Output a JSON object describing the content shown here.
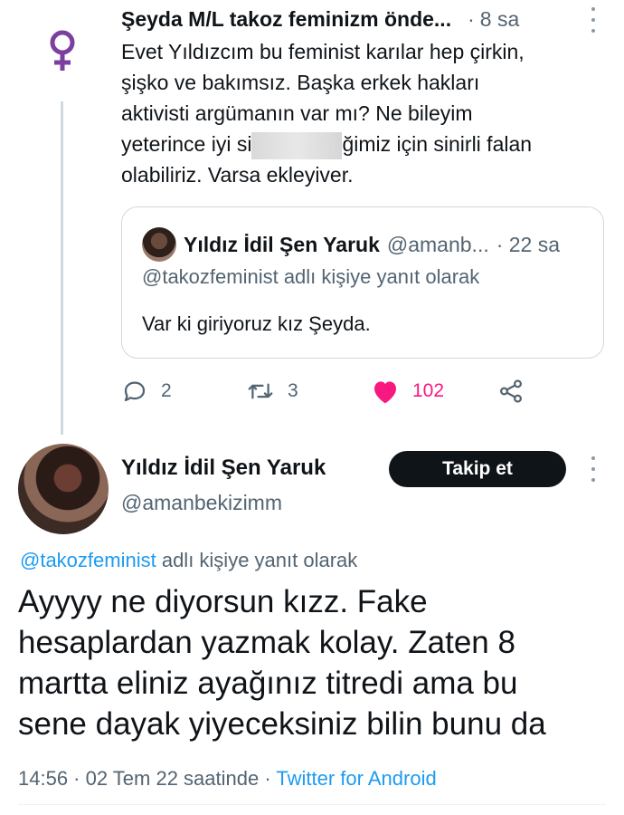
{
  "tweet1": {
    "author": "Şeyda M/L takoz feminizm önde...",
    "time_sep": "·",
    "time": "8 sa",
    "symbol": "♀",
    "text_lines": [
      "Evet Yıldızcım bu feminist karılar hep çirkin,",
      "şişko ve bakımsız. Başka erkek hakları",
      "aktivisti argümanın var mı? Ne bileyim"
    ],
    "line4_start": "yeterince iyi si",
    "line4_end": "ğimiz için sinirli falan",
    "line5": "olabiliriz. Varsa ekleyiver.",
    "quote": {
      "author": "Yıldız İdil Şen Yaruk",
      "handle": "@amanb...",
      "time": "· 22 sa",
      "reply_to": "@takozfeminist adlı kişiye yanıt olarak",
      "text": "Var ki giriyoruz kız Şeyda."
    },
    "actions": {
      "replies": "2",
      "retweets": "3",
      "likes": "102"
    }
  },
  "main_tweet": {
    "author": "Yıldız İdil Şen Yaruk",
    "handle": "@amanbekizimm",
    "follow_label": "Takip et",
    "reply_mention": "@takozfeminist",
    "reply_rest": " adlı kişiye yanıt olarak",
    "body_lines": [
      "Ayyyy ne diyorsun kızz. Fake",
      "hesaplardan yazmak kolay. Zaten 8",
      "martta eliniz ayağınız titredi ama bu",
      "sene dayak yiyeceksiniz bilin bunu da"
    ],
    "timestamp": "14:56 · 02 Tem 22 saatinde · ",
    "source": "Twitter for Android"
  },
  "colors": {
    "like": "#f91880",
    "link": "#1d9bf0",
    "symbol": "#7b3fa0"
  }
}
